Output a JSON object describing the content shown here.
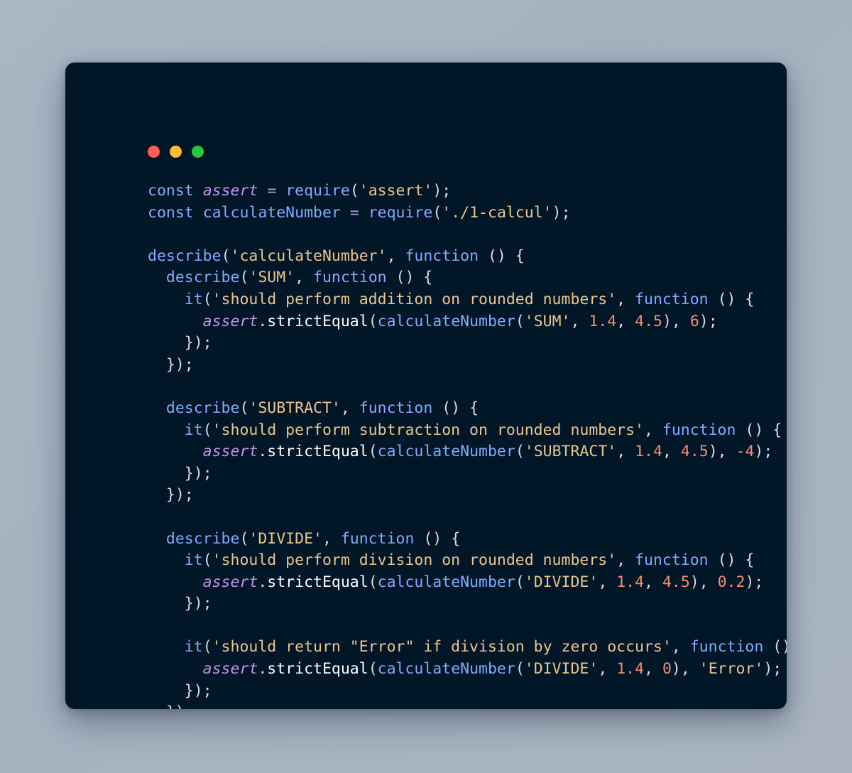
{
  "window": {
    "background_color": "#011627",
    "page_background_color": "#a8b5c3",
    "traffic_lights": [
      {
        "name": "close",
        "color": "#ff5f57"
      },
      {
        "name": "minimize",
        "color": "#febc2e"
      },
      {
        "name": "maximize",
        "color": "#28c840"
      }
    ]
  },
  "palette": {
    "keyword": "#82aaff",
    "variable_italic": "#c792ea",
    "operator": "#c792ea",
    "function": "#82aaff",
    "identifier": "#82aaff",
    "string": "#ecc48d",
    "number": "#f78c6c",
    "punctuation": "#d6deeb",
    "method": "#ffffff"
  },
  "code": {
    "language": "javascript",
    "lines": [
      "const assert = require('assert');",
      "const calculateNumber = require('./1-calcul');",
      "",
      "describe('calculateNumber', function () {",
      "  describe('SUM', function () {",
      "    it('should perform addition on rounded numbers', function () {",
      "      assert.strictEqual(calculateNumber('SUM', 1.4, 4.5), 6);",
      "    });",
      "  });",
      "",
      "  describe('SUBTRACT', function () {",
      "    it('should perform subtraction on rounded numbers', function () {",
      "      assert.strictEqual(calculateNumber('SUBTRACT', 1.4, 4.5), -4);",
      "    });",
      "  });",
      "",
      "  describe('DIVIDE', function () {",
      "    it('should perform division on rounded numbers', function () {",
      "      assert.strictEqual(calculateNumber('DIVIDE', 1.4, 4.5), 0.2);",
      "    });",
      "",
      "    it('should return \"Error\" if division by zero occurs', function () {",
      "      assert.strictEqual(calculateNumber('DIVIDE', 1.4, 0), 'Error');",
      "    });",
      "  });",
      "});"
    ],
    "tokens": [
      [
        [
          "const",
          "t-const"
        ],
        [
          " ",
          "t-plain"
        ],
        [
          "assert",
          "t-var"
        ],
        [
          " ",
          "t-plain"
        ],
        [
          "=",
          "t-op"
        ],
        [
          " ",
          "t-plain"
        ],
        [
          "require",
          "t-fn"
        ],
        [
          "(",
          "t-punc"
        ],
        [
          "'assert'",
          "t-str"
        ],
        [
          ")",
          "t-punc"
        ],
        [
          ";",
          "t-punc"
        ]
      ],
      [
        [
          "const",
          "t-const"
        ],
        [
          " ",
          "t-plain"
        ],
        [
          "calculateNumber",
          "t-ident"
        ],
        [
          " ",
          "t-plain"
        ],
        [
          "=",
          "t-op"
        ],
        [
          " ",
          "t-plain"
        ],
        [
          "require",
          "t-fn"
        ],
        [
          "(",
          "t-punc"
        ],
        [
          "'./1-calcul'",
          "t-str"
        ],
        [
          ")",
          "t-punc"
        ],
        [
          ";",
          "t-punc"
        ]
      ],
      [],
      [
        [
          "describe",
          "t-fn"
        ],
        [
          "(",
          "t-punc"
        ],
        [
          "'calculateNumber'",
          "t-str"
        ],
        [
          ", ",
          "t-punc"
        ],
        [
          "function",
          "t-fn"
        ],
        [
          " () {",
          "t-punc"
        ]
      ],
      [
        [
          "  ",
          "t-plain"
        ],
        [
          "describe",
          "t-fn"
        ],
        [
          "(",
          "t-punc"
        ],
        [
          "'SUM'",
          "t-str"
        ],
        [
          ", ",
          "t-punc"
        ],
        [
          "function",
          "t-fn"
        ],
        [
          " () {",
          "t-punc"
        ]
      ],
      [
        [
          "    ",
          "t-plain"
        ],
        [
          "it",
          "t-fn"
        ],
        [
          "(",
          "t-punc"
        ],
        [
          "'should perform addition on rounded numbers'",
          "t-str"
        ],
        [
          ", ",
          "t-punc"
        ],
        [
          "function",
          "t-fn"
        ],
        [
          " () {",
          "t-punc"
        ]
      ],
      [
        [
          "      ",
          "t-plain"
        ],
        [
          "assert",
          "t-var"
        ],
        [
          ".",
          "t-punc"
        ],
        [
          "strictEqual",
          "t-method"
        ],
        [
          "(",
          "t-punc"
        ],
        [
          "calculateNumber",
          "t-ident"
        ],
        [
          "(",
          "t-punc"
        ],
        [
          "'SUM'",
          "t-str"
        ],
        [
          ", ",
          "t-punc"
        ],
        [
          "1.4",
          "t-num"
        ],
        [
          ", ",
          "t-punc"
        ],
        [
          "4.5",
          "t-num"
        ],
        [
          "), ",
          "t-punc"
        ],
        [
          "6",
          "t-num"
        ],
        [
          ");",
          "t-punc"
        ]
      ],
      [
        [
          "    ",
          "t-plain"
        ],
        [
          "});",
          "t-punc"
        ]
      ],
      [
        [
          "  ",
          "t-plain"
        ],
        [
          "});",
          "t-punc"
        ]
      ],
      [],
      [
        [
          "  ",
          "t-plain"
        ],
        [
          "describe",
          "t-fn"
        ],
        [
          "(",
          "t-punc"
        ],
        [
          "'SUBTRACT'",
          "t-str"
        ],
        [
          ", ",
          "t-punc"
        ],
        [
          "function",
          "t-fn"
        ],
        [
          " () {",
          "t-punc"
        ]
      ],
      [
        [
          "    ",
          "t-plain"
        ],
        [
          "it",
          "t-fn"
        ],
        [
          "(",
          "t-punc"
        ],
        [
          "'should perform subtraction on rounded numbers'",
          "t-str"
        ],
        [
          ", ",
          "t-punc"
        ],
        [
          "function",
          "t-fn"
        ],
        [
          " () {",
          "t-punc"
        ]
      ],
      [
        [
          "      ",
          "t-plain"
        ],
        [
          "assert",
          "t-var"
        ],
        [
          ".",
          "t-punc"
        ],
        [
          "strictEqual",
          "t-method"
        ],
        [
          "(",
          "t-punc"
        ],
        [
          "calculateNumber",
          "t-ident"
        ],
        [
          "(",
          "t-punc"
        ],
        [
          "'SUBTRACT'",
          "t-str"
        ],
        [
          ", ",
          "t-punc"
        ],
        [
          "1.4",
          "t-num"
        ],
        [
          ", ",
          "t-punc"
        ],
        [
          "4.5",
          "t-num"
        ],
        [
          "), ",
          "t-punc"
        ],
        [
          "-4",
          "t-num"
        ],
        [
          ");",
          "t-punc"
        ]
      ],
      [
        [
          "    ",
          "t-plain"
        ],
        [
          "});",
          "t-punc"
        ]
      ],
      [
        [
          "  ",
          "t-plain"
        ],
        [
          "});",
          "t-punc"
        ]
      ],
      [],
      [
        [
          "  ",
          "t-plain"
        ],
        [
          "describe",
          "t-fn"
        ],
        [
          "(",
          "t-punc"
        ],
        [
          "'DIVIDE'",
          "t-str"
        ],
        [
          ", ",
          "t-punc"
        ],
        [
          "function",
          "t-fn"
        ],
        [
          " () {",
          "t-punc"
        ]
      ],
      [
        [
          "    ",
          "t-plain"
        ],
        [
          "it",
          "t-fn"
        ],
        [
          "(",
          "t-punc"
        ],
        [
          "'should perform division on rounded numbers'",
          "t-str"
        ],
        [
          ", ",
          "t-punc"
        ],
        [
          "function",
          "t-fn"
        ],
        [
          " () {",
          "t-punc"
        ]
      ],
      [
        [
          "      ",
          "t-plain"
        ],
        [
          "assert",
          "t-var"
        ],
        [
          ".",
          "t-punc"
        ],
        [
          "strictEqual",
          "t-method"
        ],
        [
          "(",
          "t-punc"
        ],
        [
          "calculateNumber",
          "t-ident"
        ],
        [
          "(",
          "t-punc"
        ],
        [
          "'DIVIDE'",
          "t-str"
        ],
        [
          ", ",
          "t-punc"
        ],
        [
          "1.4",
          "t-num"
        ],
        [
          ", ",
          "t-punc"
        ],
        [
          "4.5",
          "t-num"
        ],
        [
          "), ",
          "t-punc"
        ],
        [
          "0.2",
          "t-num"
        ],
        [
          ");",
          "t-punc"
        ]
      ],
      [
        [
          "    ",
          "t-plain"
        ],
        [
          "});",
          "t-punc"
        ]
      ],
      [],
      [
        [
          "    ",
          "t-plain"
        ],
        [
          "it",
          "t-fn"
        ],
        [
          "(",
          "t-punc"
        ],
        [
          "'should return \"Error\" if division by zero occurs'",
          "t-str"
        ],
        [
          ", ",
          "t-punc"
        ],
        [
          "function",
          "t-fn"
        ],
        [
          " () {",
          "t-punc"
        ]
      ],
      [
        [
          "      ",
          "t-plain"
        ],
        [
          "assert",
          "t-var"
        ],
        [
          ".",
          "t-punc"
        ],
        [
          "strictEqual",
          "t-method"
        ],
        [
          "(",
          "t-punc"
        ],
        [
          "calculateNumber",
          "t-ident"
        ],
        [
          "(",
          "t-punc"
        ],
        [
          "'DIVIDE'",
          "t-str"
        ],
        [
          ", ",
          "t-punc"
        ],
        [
          "1.4",
          "t-num"
        ],
        [
          ", ",
          "t-punc"
        ],
        [
          "0",
          "t-num"
        ],
        [
          "), ",
          "t-punc"
        ],
        [
          "'Error'",
          "t-str"
        ],
        [
          ");",
          "t-punc"
        ]
      ],
      [
        [
          "    ",
          "t-plain"
        ],
        [
          "});",
          "t-punc"
        ]
      ],
      [
        [
          "  ",
          "t-plain"
        ],
        [
          "});",
          "t-punc"
        ]
      ],
      [
        [
          "});",
          "t-punc"
        ]
      ]
    ]
  }
}
